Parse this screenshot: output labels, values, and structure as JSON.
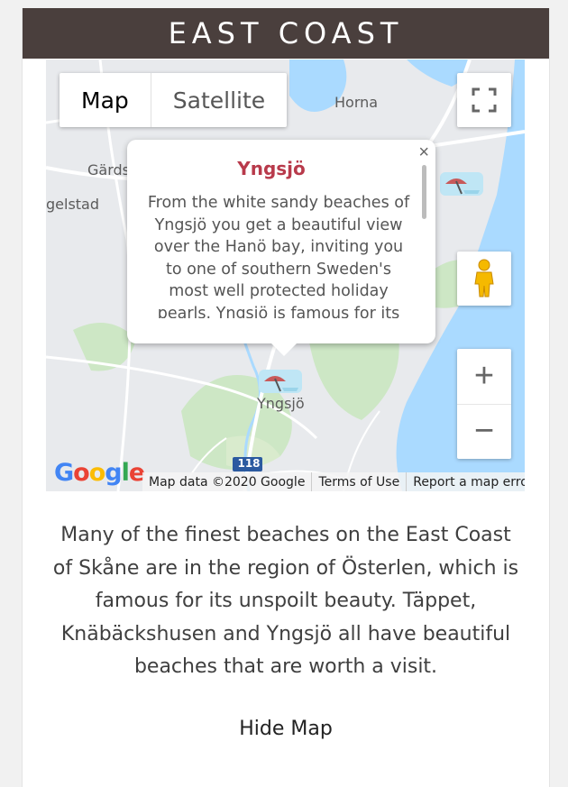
{
  "header": {
    "title": "EAST COAST"
  },
  "map": {
    "type_control": {
      "map_label": "Map",
      "satellite_label": "Satellite",
      "active": "Map"
    },
    "places": {
      "horna": "Horna",
      "gards": "Gärds",
      "gelstad": "gelstad",
      "yngsjo": "Yngsjö",
      "road_number": "118"
    },
    "info_window": {
      "title": "Yngsjö",
      "body": "From the white sandy beaches of Yngsjö you get a beautiful view over the Hanö bay, inviting you to one of southern Sweden's most well protected holiday pearls. Yngsjö is famous for its beaches and…",
      "close_symbol": "×"
    },
    "zoom": {
      "in_symbol": "+",
      "out_symbol": "−"
    },
    "footer": {
      "map_data": "Map data ©2020 Google",
      "terms": "Terms of Use",
      "report": "Report a map error"
    },
    "google_logo": "Google",
    "colors": {
      "water": "#aadaff",
      "land": "#e8eaed",
      "green": "#cde7c5",
      "road": "#ffffff"
    }
  },
  "description": "Many of the finest beaches on the East Coast of Skåne are in the region of Österlen, which is famous for its unspoilt beauty. Täppet, Knäbäckshusen and Yngsjö all have beautiful beaches that are worth a visit.",
  "hide_map_label": "Hide Map"
}
